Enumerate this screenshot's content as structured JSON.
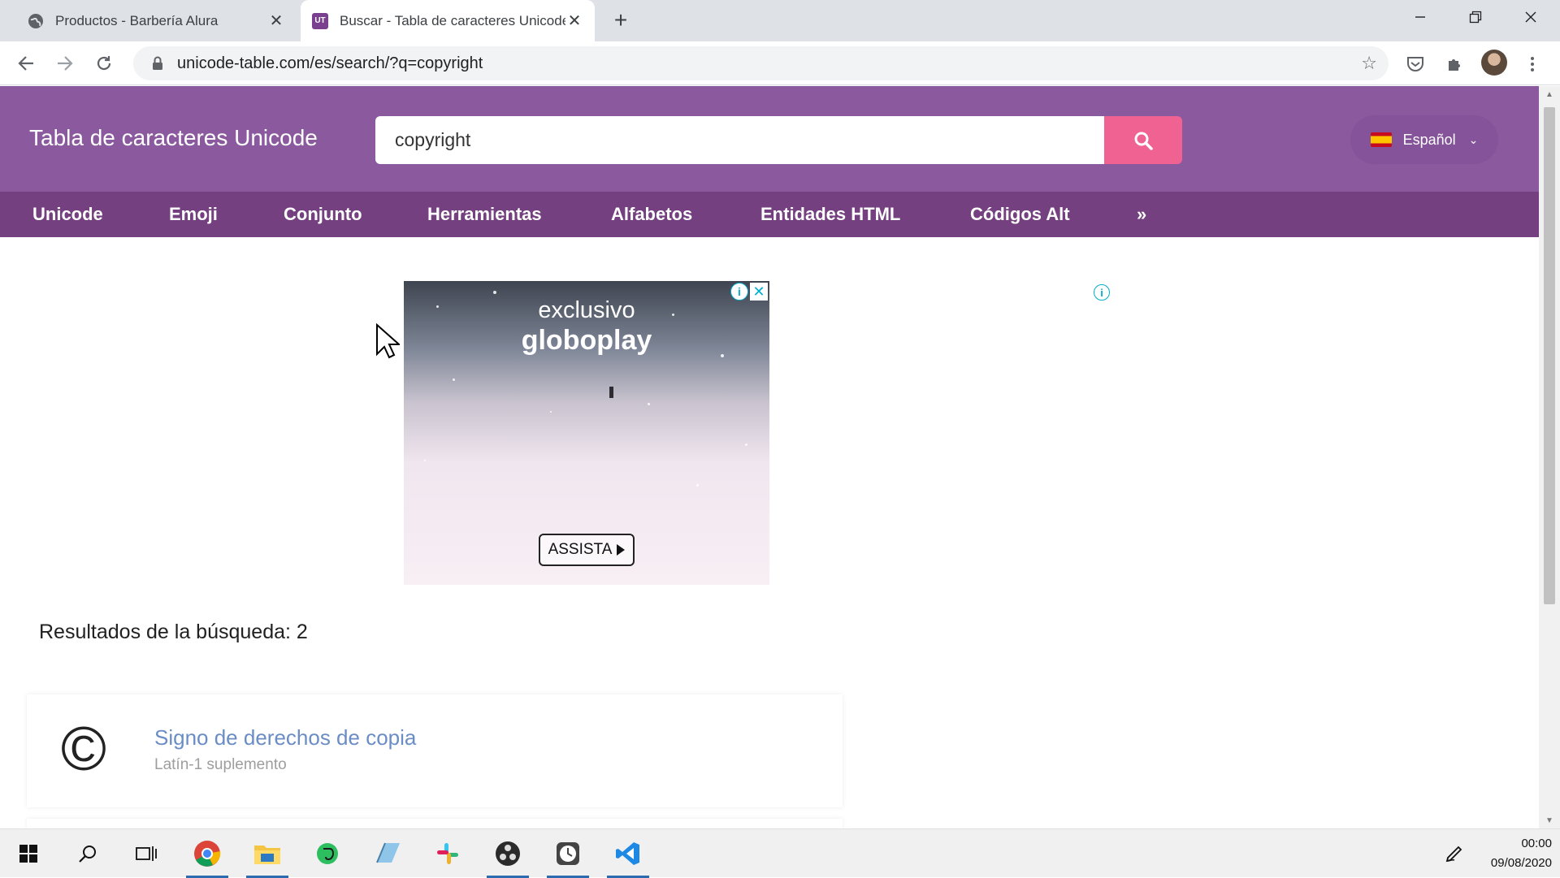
{
  "browser": {
    "tabs": [
      {
        "title": "Productos - Barbería Alura",
        "active": false
      },
      {
        "title": "Buscar - Tabla de caracteres Unicode",
        "active": true
      }
    ],
    "url": "unicode-table.com/es/search/?q=copyright"
  },
  "site": {
    "title": "Tabla de caracteres Unicode",
    "search_value": "copyright",
    "language": "Español",
    "nav": [
      "Unicode",
      "Emoji",
      "Conjunto",
      "Herramientas",
      "Alfabetos",
      "Entidades HTML",
      "Códigos Alt",
      "»"
    ]
  },
  "ad": {
    "line1": "exclusivo",
    "line2": "globoplay",
    "cta": "ASSISTA"
  },
  "results": {
    "heading": "Resultados de la búsqueda: 2",
    "items": [
      {
        "glyph": "©",
        "name": "Signo de derechos de copia",
        "block": "Latín-1 suplemento"
      }
    ]
  },
  "taskbar": {
    "time": "00:00",
    "date": "09/08/2020"
  },
  "colors": {
    "header": "#8b5a9e",
    "nav": "#74407f",
    "search_button": "#f06292",
    "result_link": "#6b8dc5"
  }
}
